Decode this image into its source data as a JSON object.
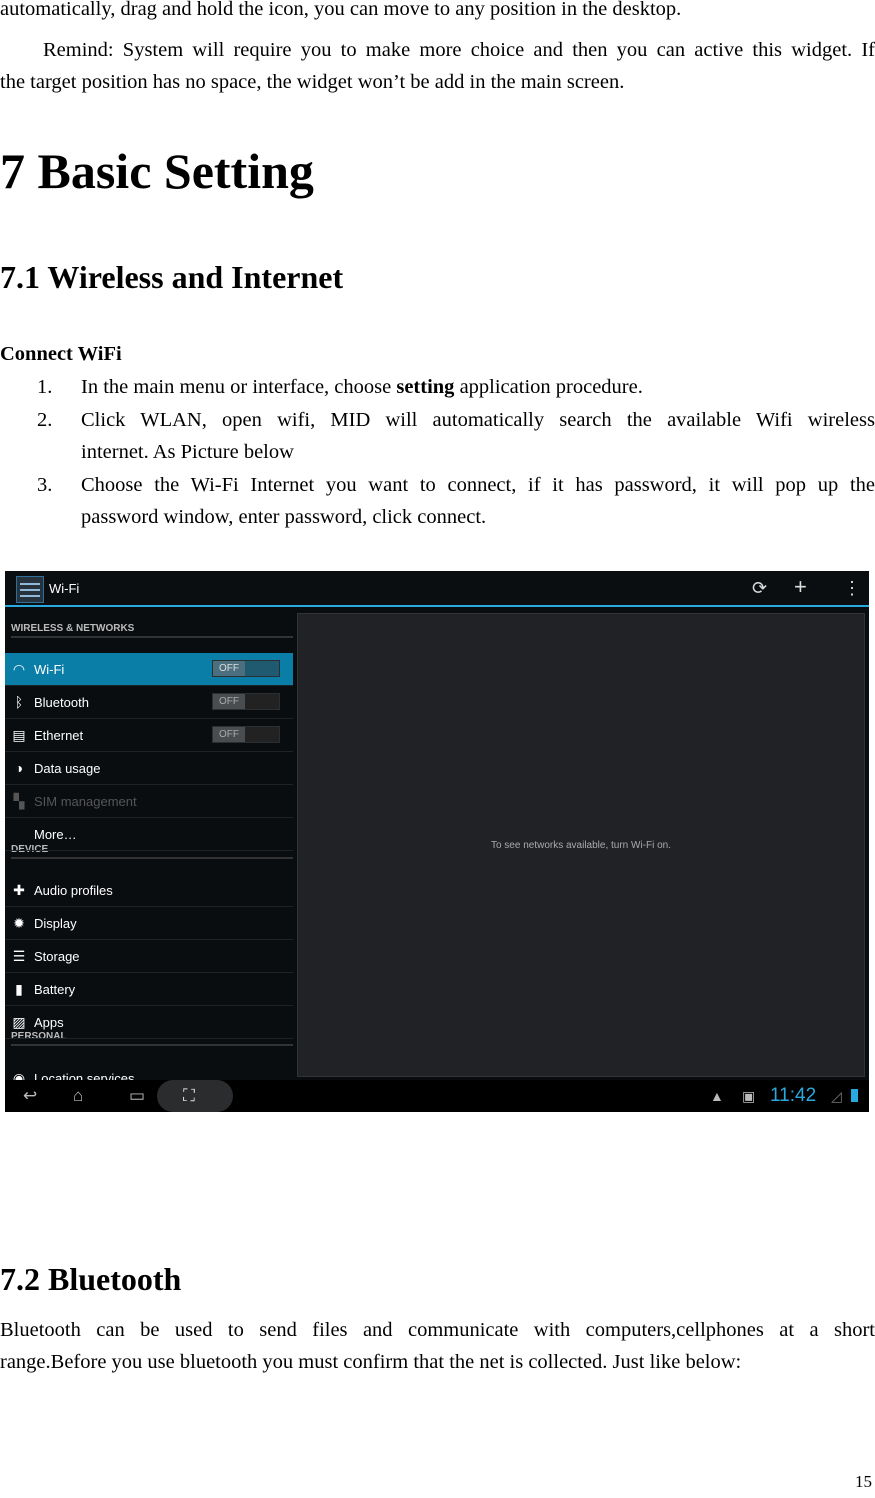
{
  "text": {
    "line0": "automatically, drag and hold the icon, you can move to any position in the desktop.",
    "remind1": "Remind: System will require you to make more choice and then you can active this widget. If",
    "remind2": "the target position has no space, the widget won’t be add in the main screen.",
    "h1": "7 Basic Setting",
    "h2a": "7.1 Wireless and Internet",
    "connect": "Connect WiFi",
    "items": [
      {
        "num": "1.",
        "pre": "In the main menu or interface, choose ",
        "bold": "setting",
        "post": " application procedure."
      },
      {
        "num": "2.",
        "l1": "Click WLAN, open wifi, MID will automatically search the available Wifi wireless",
        "l2": "internet. As Picture below"
      },
      {
        "num": "3.",
        "l1": "Choose the Wi-Fi Internet you want to connect, if it has password, it will pop up the",
        "l2": "password window, enter password, click connect."
      }
    ],
    "h2b": "7.2 Bluetooth",
    "bt1": "Bluetooth can be used to send files and communicate with computers,cellphones at a short",
    "bt2": "range.Before you use bluetooth you must confirm that the net is collected. Just like below:",
    "page": "15"
  },
  "screen": {
    "title": "Wi-Fi",
    "sections": [
      "WIRELESS & NETWORKS",
      "DEVICE",
      "PERSONAL"
    ],
    "rows": [
      {
        "label": "Wi-Fi",
        "icon": "wifi-icon",
        "toggle": "OFF"
      },
      {
        "label": "Bluetooth",
        "icon": "bluetooth-icon",
        "toggle": "OFF"
      },
      {
        "label": "Ethernet",
        "icon": "ethernet-icon",
        "toggle": "OFF"
      },
      {
        "label": "Data usage",
        "icon": "data-usage-icon"
      },
      {
        "label": "SIM management",
        "icon": "sim-icon"
      },
      {
        "label": "More…"
      },
      {
        "label": "Audio profiles",
        "icon": "audio-profiles-icon"
      },
      {
        "label": "Display",
        "icon": "display-icon"
      },
      {
        "label": "Storage",
        "icon": "storage-icon"
      },
      {
        "label": "Battery",
        "icon": "battery-icon"
      },
      {
        "label": "Apps",
        "icon": "apps-icon"
      },
      {
        "label": "Location services",
        "icon": "location-icon"
      }
    ],
    "message": "To see networks available, turn Wi-Fi on.",
    "clock": "11:42",
    "accent": "#2aa9e0",
    "selected_color": "#0b7ea8"
  }
}
